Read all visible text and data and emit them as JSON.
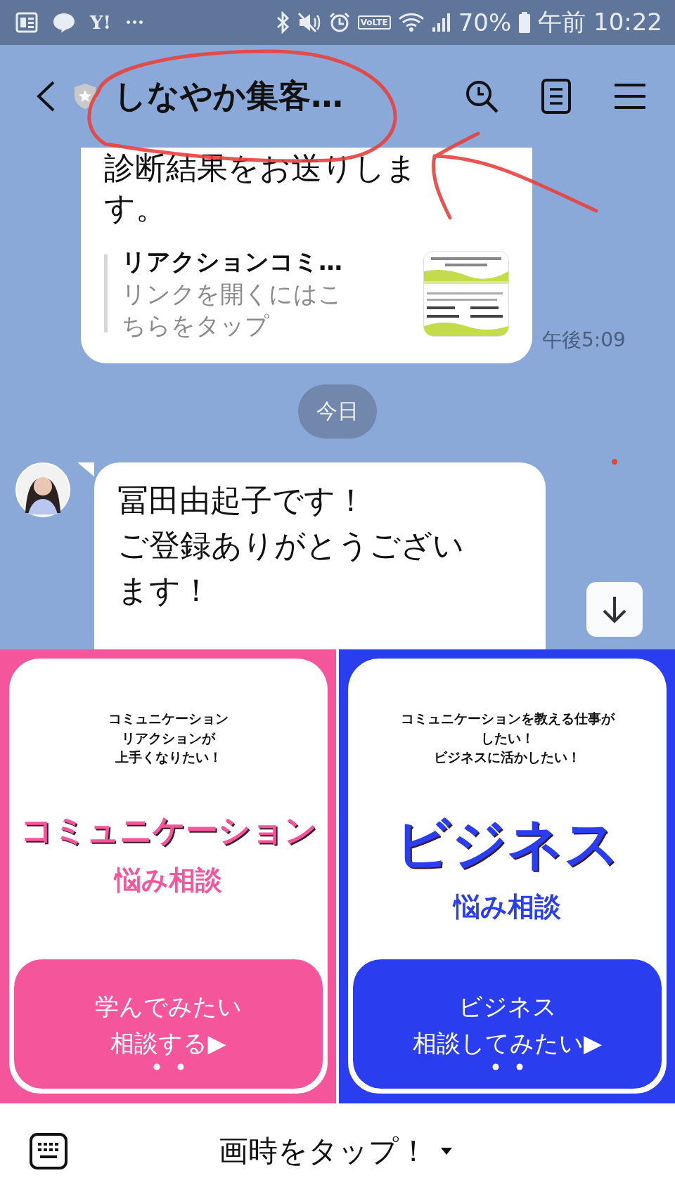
{
  "status_bar": {
    "notifications": [
      {
        "kind": "news"
      },
      {
        "kind": "chat"
      },
      {
        "kind": "text",
        "text": "Y!"
      },
      {
        "kind": "text",
        "text": "···"
      }
    ],
    "volte": "VoLTE",
    "battery": "70%",
    "time": "午前 10:22"
  },
  "header": {
    "title": "しなやか集客…"
  },
  "messages": [
    {
      "kind": "link",
      "lines": [
        "診断結果をお送りします。"
      ],
      "link_title": "リアクションコミ…",
      "link_subtitle": "リンクを開くにはこちらをタップ",
      "time": "午後5:09"
    },
    {
      "kind": "date",
      "text": "今日"
    },
    {
      "kind": "text",
      "lines": [
        "冨田由起子です！",
        "ご登録ありがとうございます！"
      ]
    }
  ],
  "rich_menu": [
    {
      "color": "#f5559a",
      "caption": [
        "コミュニケーション",
        "リアクションが",
        "上手くなりたい！"
      ],
      "title": "コミュニケーション",
      "subtitle": "悩み相談",
      "button": [
        "学んでみたい",
        "相談する▶"
      ]
    },
    {
      "color": "#2a3ef0",
      "caption": [
        "コミュニケーションを教える仕事が",
        "したい！",
        "ビジネスに活かしたい！"
      ],
      "title": "ビジネス",
      "subtitle": "悩み相談",
      "button": [
        "ビジネス",
        "相談してみたい▶"
      ]
    }
  ],
  "menu_bar": {
    "label": "画時をタップ！"
  }
}
